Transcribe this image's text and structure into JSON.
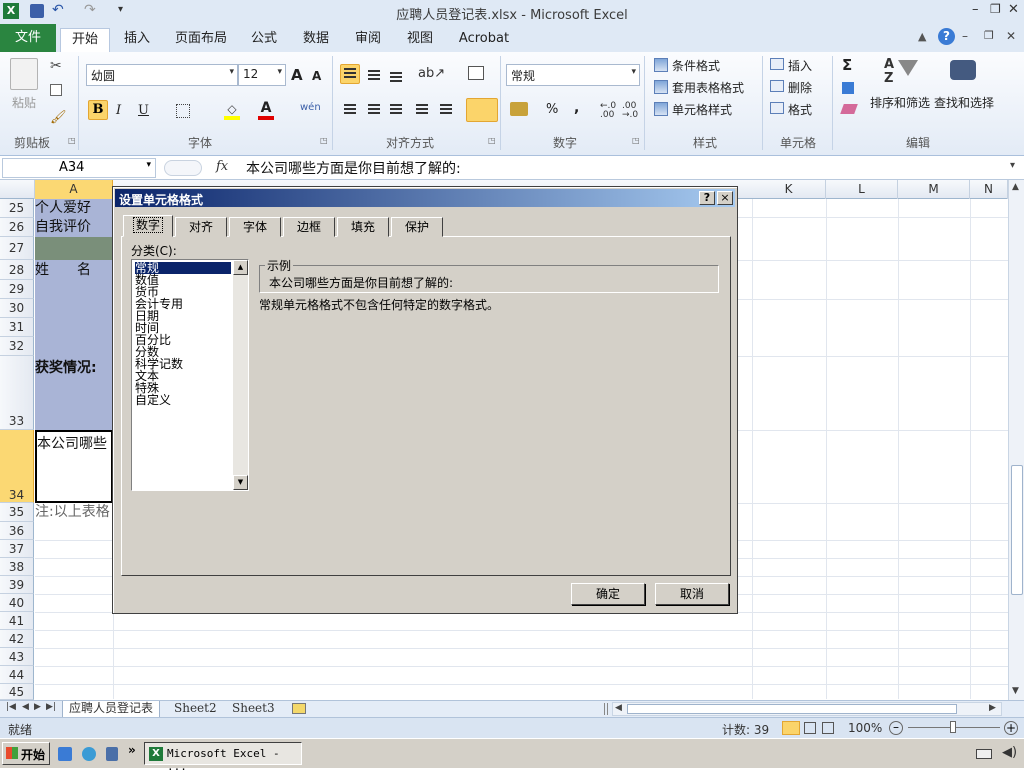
{
  "window": {
    "title": "应聘人员登记表.xlsx  -  Microsoft Excel"
  },
  "ribbon_tabs": [
    "文件",
    "开始",
    "插入",
    "页面布局",
    "公式",
    "数据",
    "审阅",
    "视图",
    "Acrobat"
  ],
  "ribbon": {
    "clipboard": {
      "paste": "粘贴",
      "label": "剪贴板"
    },
    "font": {
      "name": "幼圆",
      "size": "12",
      "label": "字体",
      "bold": "B",
      "italic": "I",
      "underline": "U",
      "grow": "A",
      "shrink": "A",
      "phonetic": "wén"
    },
    "alignment": {
      "label": "对齐方式"
    },
    "number": {
      "format": "常规",
      "label": "数字",
      "percent": "%",
      "comma": ",",
      "inc_decimal": "←.0\n.00",
      "dec_decimal": ".00\n→.0"
    },
    "styles": {
      "label": "样式",
      "conditional": "条件格式",
      "table": "套用表格格式",
      "cell_styles": "单元格样式"
    },
    "cells": {
      "label": "单元格",
      "insert": "插入",
      "delete": "删除",
      "format": "格式"
    },
    "editing": {
      "label": "编辑",
      "sigma": "Σ",
      "sort": "排序和筛选",
      "find": "查找和选择"
    }
  },
  "formula_bar": {
    "name_box": "A34",
    "fx": "fx",
    "content": "本公司哪些方面是你目前想了解的:"
  },
  "columns": [
    "A",
    "K",
    "L",
    "M",
    "N"
  ],
  "rows": [
    {
      "num": "25",
      "text": "个人爱好"
    },
    {
      "num": "26",
      "text": "自我评价"
    },
    {
      "num": "27",
      "text": ""
    },
    {
      "num": "28",
      "text": "姓　　名"
    },
    {
      "num": "29",
      "text": ""
    },
    {
      "num": "30",
      "text": ""
    },
    {
      "num": "31",
      "text": ""
    },
    {
      "num": "32",
      "text": ""
    },
    {
      "num": "33",
      "text": "获奖情况:"
    },
    {
      "num": "34",
      "text": "本公司哪些"
    },
    {
      "num": "35",
      "text": "注:以上表格"
    },
    {
      "num": "36",
      "text": ""
    },
    {
      "num": "37",
      "text": ""
    },
    {
      "num": "38",
      "text": ""
    },
    {
      "num": "39",
      "text": ""
    },
    {
      "num": "40",
      "text": ""
    },
    {
      "num": "41",
      "text": ""
    },
    {
      "num": "42",
      "text": ""
    },
    {
      "num": "43",
      "text": ""
    },
    {
      "num": "44",
      "text": ""
    },
    {
      "num": "45",
      "text": ""
    }
  ],
  "sheets": [
    "应聘人员登记表",
    "Sheet2",
    "Sheet3"
  ],
  "status": {
    "ready": "就绪",
    "count": "计数: 39",
    "zoom": "100%"
  },
  "dialog": {
    "title": "设置单元格格式",
    "help": "?",
    "close": "×",
    "tabs": [
      "数字",
      "对齐",
      "字体",
      "边框",
      "填充",
      "保护"
    ],
    "category_label": "分类(C):",
    "categories": [
      "常规",
      "数值",
      "货币",
      "会计专用",
      "日期",
      "时间",
      "百分比",
      "分数",
      "科学记数",
      "文本",
      "特殊",
      "自定义"
    ],
    "selected_category": "常规",
    "sample_label": "示例",
    "sample_value": "本公司哪些方面是你目前想了解的:",
    "description": "常规单元格格式不包含任何特定的数字格式。",
    "ok": "确定",
    "cancel": "取消"
  },
  "taskbar": {
    "start": "开始",
    "window": "Microsoft Excel - ..."
  },
  "colors": {
    "file_tab": "#2a8540",
    "dialog_title": "#0a246a",
    "selected_row_header": "#fbd873",
    "cell_fill": "#a9b4d6"
  }
}
